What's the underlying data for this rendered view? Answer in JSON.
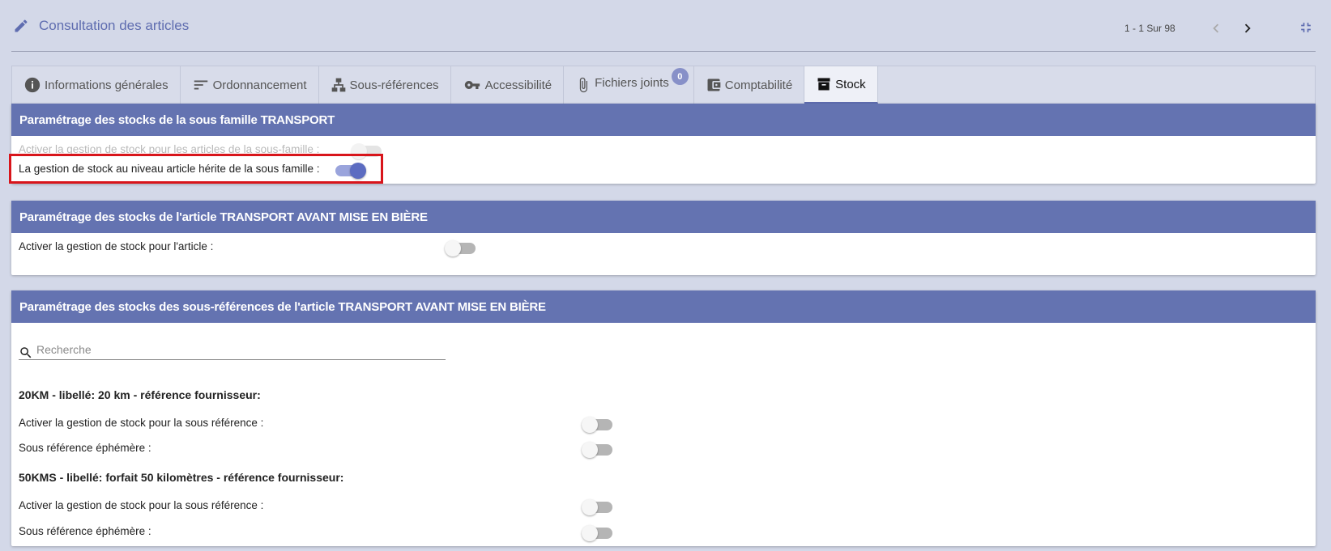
{
  "header": {
    "title": "Consultation des articles",
    "pager": "1 - 1 Sur 98",
    "icons": {
      "edit": "pencil-icon",
      "prev": "chevron-left-icon",
      "next": "chevron-right-icon",
      "compress": "compress-icon"
    }
  },
  "tabs": [
    {
      "label": "Informations générales",
      "icon": "info-icon"
    },
    {
      "label": "Ordonnancement",
      "icon": "sort-icon"
    },
    {
      "label": "Sous-références",
      "icon": "hierarchy-icon"
    },
    {
      "label": "Accessibilité",
      "icon": "key-icon"
    },
    {
      "label": "Fichiers joints",
      "icon": "paperclip-icon",
      "badge": "0"
    },
    {
      "label": "Comptabilité",
      "icon": "wallet-icon"
    },
    {
      "label": "Stock",
      "icon": "archive-icon",
      "active": true
    }
  ],
  "family_panel": {
    "title": "Paramétrage des stocks de la sous famille TRANSPORT",
    "row1": {
      "label": "Activer la gestion de stock pour les articles de la sous-famille :",
      "toggle": false,
      "disabled": true
    },
    "row2": {
      "label": "La gestion de stock au niveau article hérite de la sous famille :",
      "toggle": true
    }
  },
  "article_panel": {
    "title": "Paramétrage des stocks de l'article TRANSPORT AVANT MISE EN BIÈRE",
    "row1": {
      "label": "Activer la gestion de stock pour l'article :",
      "toggle": false
    }
  },
  "subref_panel": {
    "title": "Paramétrage des stocks des sous-références de l'article TRANSPORT AVANT MISE EN BIÈRE",
    "search_placeholder": "Recherche",
    "groups": [
      {
        "heading": "20KM - libellé: 20 km - référence fournisseur:",
        "stock_label": "Activer la gestion de stock pour la sous référence :",
        "stock_toggle": false,
        "ephemeral_label": "Sous référence éphémère :",
        "ephemeral_toggle": false
      },
      {
        "heading": "50KMS - libellé: forfait 50 kilomètres - référence fournisseur:",
        "stock_label": "Activer la gestion de stock pour la sous référence :",
        "stock_toggle": false,
        "ephemeral_label": "Sous référence éphémère :",
        "ephemeral_toggle": false
      }
    ]
  },
  "colors": {
    "accent": "#6473b1",
    "highlight": "#d8151b",
    "background": "#d3d8e8"
  }
}
